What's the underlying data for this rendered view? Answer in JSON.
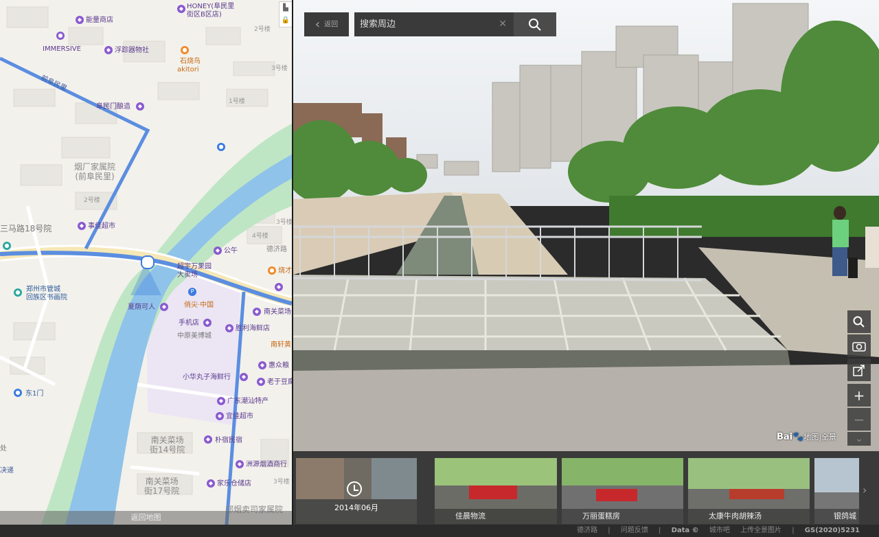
{
  "map": {
    "back_label": "返回地图",
    "labels": {
      "honey": "HONEY(阜民里\n街区B区店)",
      "nengliang": "能量商店",
      "immersive": "IMMERSIVE",
      "fuzong": "浮踪器物社",
      "shishaoniao": "石烧鸟",
      "kitori": "akitori",
      "fuminmen": "阜民门酿造",
      "fuminli": "前阜民里",
      "yanchang": "烟厂家属院\n(前阜民里)",
      "jiangkang": "事佳超市",
      "malu": "三马路18号院",
      "gonggu": "公午",
      "chaoyu": "超宇万果园\n大卖场",
      "dejilu": "德济路",
      "zhengzhou": "郑州市管城\n回族区书画院",
      "xiameng": "夏荫可人",
      "beijian": "俏尖·中国",
      "nanguan_cai": "南关菜场",
      "shouji": "手机店",
      "shengli": "胜利海鲜店",
      "zhongyuan": "中原美博城",
      "nanxuan": "南轩黄",
      "huizhong": "惠众粮",
      "xiaohua": "小华丸子海鲜行",
      "laoyu": "老于豆腐",
      "guangdong": "广东潮汕特产",
      "yijia": "宜佳超市",
      "dongyimen": "东1门",
      "nanguan14": "南关菜场\n街14号院",
      "puzhi": "朴宿民宿",
      "zhouyuan": "洲源烟酒商行",
      "nanguan17": "南关菜场\n街17号院",
      "jiale": "家乐仓储店",
      "zhengyan": "郑烟卖司家属院",
      "chu": "处",
      "jue": "决递",
      "xiao": "烧才"
    },
    "buildings": [
      "2号楼",
      "3号楼",
      "1号楼",
      "2号楼",
      "4号楼",
      "3号楼",
      "3号楼"
    ]
  },
  "search": {
    "back_label": "返回",
    "placeholder": "搜索周边"
  },
  "pano": {
    "logo_main": "Bai",
    "logo_sub": "地图|全景"
  },
  "strip": {
    "date": "2014年06月",
    "thumbs": [
      {
        "label": "佳晨物流"
      },
      {
        "label": "万丽蛋糕房"
      },
      {
        "label": "太康牛肉胡辣汤"
      },
      {
        "label": "银鸽城"
      }
    ]
  },
  "footer": {
    "street": "德济路",
    "feedback": "问题反馈",
    "data": "Data ©",
    "city": "城市吧",
    "upload": "上传全景图片",
    "license": "GS(2020)5231"
  },
  "colors": {
    "river": "#8fc3ea",
    "route": "#5b8ee0",
    "green": "#bfe6c4"
  }
}
